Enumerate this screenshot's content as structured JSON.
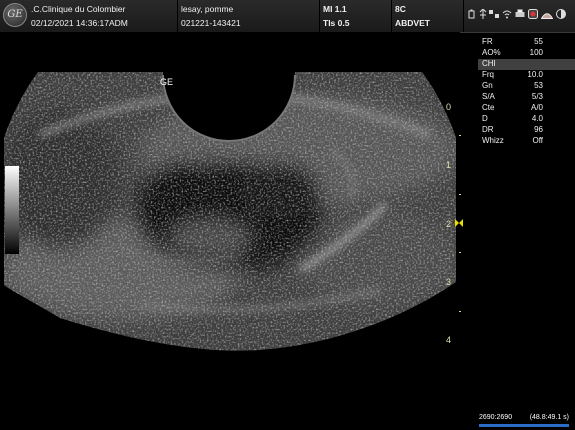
{
  "header": {
    "institution": ".C.Clinique du Colombier",
    "datetime": "02/12/2021 14:36:17ADM",
    "patient_name": "lesay, pomme",
    "patient_id": "021221-143421",
    "mi": "MI 1.1",
    "tis": "TIs 0.5",
    "probe": "8C",
    "preset": "ABDVET",
    "status_icons": [
      "battery-icon",
      "usb-icon",
      "network-icon",
      "wifi-icon",
      "print-icon",
      "record-icon",
      "probe-icon",
      "brightness-icon"
    ]
  },
  "logo_text": "GE",
  "probe_marker": "GE",
  "params": [
    {
      "key": "FR",
      "value": "55",
      "selected": false
    },
    {
      "key": "AO%",
      "value": "100",
      "selected": false
    },
    {
      "key": "CHI",
      "value": "",
      "selected": true
    },
    {
      "key": "Frq",
      "value": "10.0",
      "selected": false
    },
    {
      "key": "Gn",
      "value": "53",
      "selected": false
    },
    {
      "key": "S/A",
      "value": "5/3",
      "selected": false
    },
    {
      "key": "Cte",
      "value": "A/0",
      "selected": false
    },
    {
      "key": "D",
      "value": "4.0",
      "selected": false
    },
    {
      "key": "DR",
      "value": "96",
      "selected": false
    },
    {
      "key": "Whizz",
      "value": "Off",
      "selected": false
    }
  ],
  "depth_scale": {
    "labels": [
      "0",
      "1",
      "2",
      "3",
      "4"
    ],
    "max_cm": 4.0,
    "focus_cm": 2.0
  },
  "cine": {
    "frames": "2690:2690",
    "time": "(48.8:49.1 s)",
    "progress": 1.0
  },
  "colors": {
    "header_bg": "#1e1e1e",
    "depth_scale": "#e0e0b0",
    "focus_marker": "#e8e000",
    "cine_bar": "#2a6cc8"
  }
}
